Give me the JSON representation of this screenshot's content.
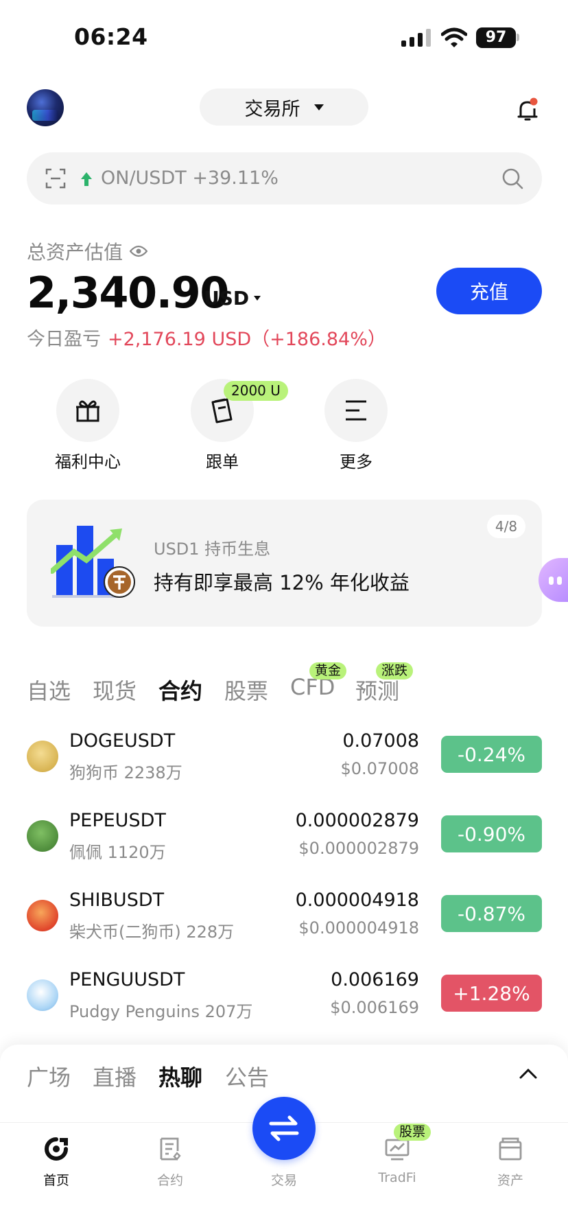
{
  "status_bar": {
    "time": "06:24",
    "battery": "97"
  },
  "header": {
    "exchange_label": "交易所"
  },
  "search": {
    "ticker_text": "ON/USDT +39.11%"
  },
  "assets": {
    "label": "总资产估值",
    "amount": "2,340.90",
    "currency": "USD",
    "deposit_label": "充值",
    "pnl_label": "今日盈亏",
    "pnl_value": "+2,176.19 USD（+186.84%）"
  },
  "shortcuts": [
    {
      "label": "福利中心",
      "icon": "gift-icon"
    },
    {
      "label": "跟单",
      "icon": "copy-trade-icon",
      "badge": "2000 U"
    },
    {
      "label": "更多",
      "icon": "menu-icon"
    }
  ],
  "banner": {
    "subtitle": "USD1 持币生息",
    "title": "持有即享最高 12% 年化收益",
    "pager": "4/8"
  },
  "market_tabs": [
    {
      "label": "自选",
      "active": false
    },
    {
      "label": "现货",
      "active": false
    },
    {
      "label": "合约",
      "active": true
    },
    {
      "label": "股票",
      "active": false
    },
    {
      "label": "CFD",
      "active": false,
      "badge": "黄金"
    },
    {
      "label": "预测",
      "active": false,
      "badge": "涨跌"
    }
  ],
  "rows": [
    {
      "symbol": "DOGEUSDT",
      "sub": "狗狗币 2238万",
      "price": "0.07008",
      "usd": "$0.07008",
      "change": "-0.24%",
      "direction": "down",
      "color": "#d8b453"
    },
    {
      "symbol": "PEPEUSDT",
      "sub": "佩佩 1120万",
      "price": "0.000002879",
      "usd": "$0.000002879",
      "change": "-0.90%",
      "direction": "down",
      "color": "#4f8d3c"
    },
    {
      "symbol": "SHIBUSDT",
      "sub": "柴犬币(二狗币) 228万",
      "price": "0.000004918",
      "usd": "$0.000004918",
      "change": "-0.87%",
      "direction": "down",
      "color": "#e0452b"
    },
    {
      "symbol": "PENGUUSDT",
      "sub": "Pudgy Penguins 207万",
      "price": "0.006169",
      "usd": "$0.006169",
      "change": "+1.28%",
      "direction": "up",
      "color": "#a9d4f5"
    }
  ],
  "feed_tabs": [
    {
      "label": "广场",
      "active": false
    },
    {
      "label": "直播",
      "active": false
    },
    {
      "label": "热聊",
      "active": true
    },
    {
      "label": "公告",
      "active": false
    }
  ],
  "bottom_nav": {
    "home": "首页",
    "contract": "合约",
    "trade": "交易",
    "tradfi": "TradFi",
    "tradfi_badge": "股票",
    "assets": "资产"
  },
  "colors": {
    "accent": "#1b4bf5",
    "up": "#e35466",
    "down": "#5cc28a",
    "badge": "#b9f27a"
  }
}
